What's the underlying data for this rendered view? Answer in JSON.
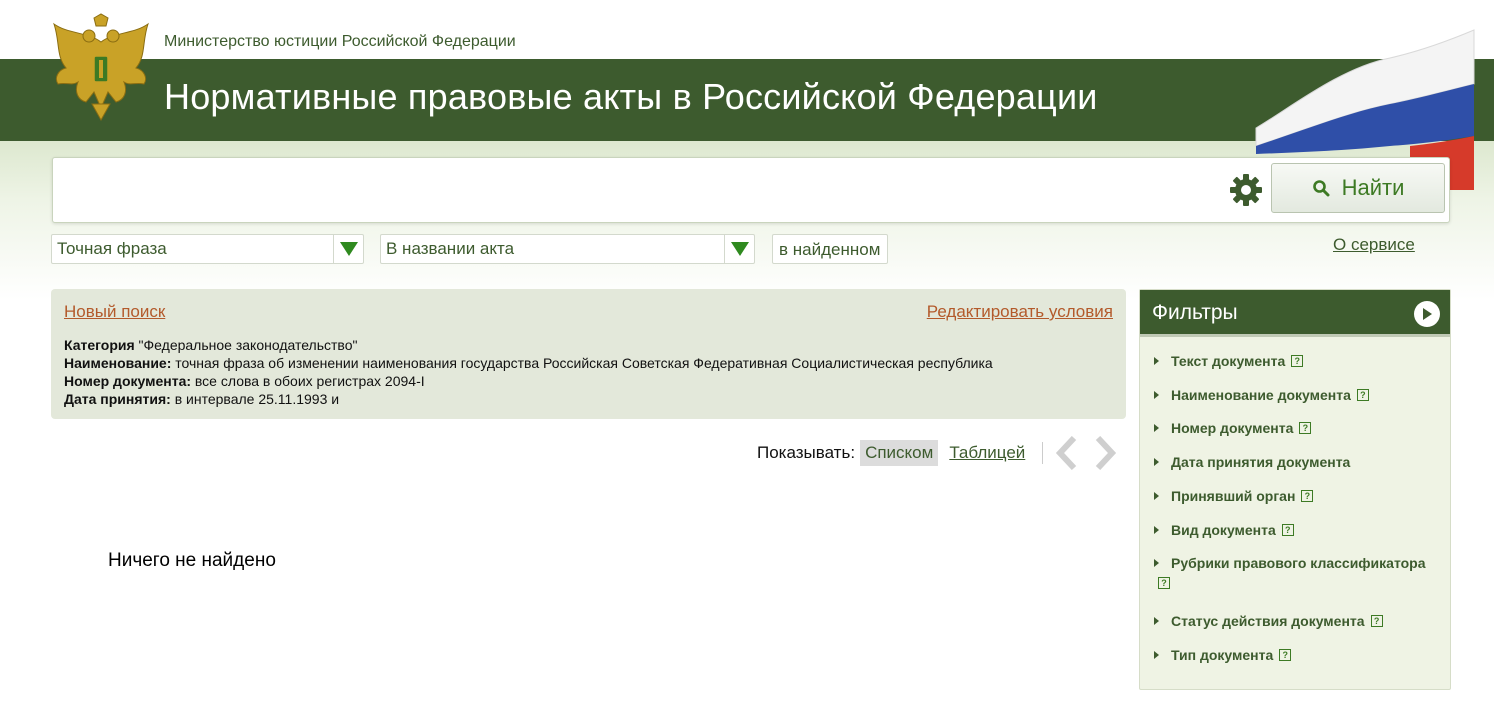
{
  "header": {
    "ministry": "Министерство юстиции Российской Федерации",
    "title": "Нормативные правовые акты в Российской Федерации"
  },
  "search": {
    "value": "",
    "placeholder": "",
    "button_label": "Найти"
  },
  "options": {
    "phrase_mode": "Точная фраза",
    "search_scope": "В названии акта",
    "in_found": "в найденном",
    "about_link": "О сервисе"
  },
  "conditions": {
    "new_search": "Новый поиск",
    "edit": "Редактировать условия",
    "lines": [
      {
        "label": "Категория",
        "value": " \"Федеральное законодательство\""
      },
      {
        "label": "Наименование:",
        "value": " точная фраза об изменении наименования государства Российская Советская Федеративная Социалистическая республика"
      },
      {
        "label": "Номер документа:",
        "value": " все слова в обоих регистрах 2094-I"
      },
      {
        "label": "Дата принятия:",
        "value": " в интервале 25.11.1993 и"
      }
    ]
  },
  "view": {
    "label": "Показывать:",
    "list": "Списком",
    "table": "Таблицей"
  },
  "results": {
    "empty_message": "Ничего не найдено"
  },
  "filters": {
    "title": "Фильтры",
    "items": [
      {
        "label": "Текст документа",
        "help": true
      },
      {
        "label": "Наименование документа",
        "help": true
      },
      {
        "label": "Номер документа",
        "help": true
      },
      {
        "label": "Дата принятия документа",
        "help": false
      },
      {
        "label": "Принявший орган",
        "help": true
      },
      {
        "label": "Вид документа",
        "help": true
      },
      {
        "label": "Рубрики правового классификатора",
        "help": true
      },
      {
        "label": "Статус действия документа",
        "help": true
      },
      {
        "label": "Тип документа",
        "help": true
      }
    ]
  },
  "colors": {
    "brand_green": "#3d5b2e",
    "link_orange": "#b35a2b",
    "panel_bg": "#e3e8da"
  }
}
